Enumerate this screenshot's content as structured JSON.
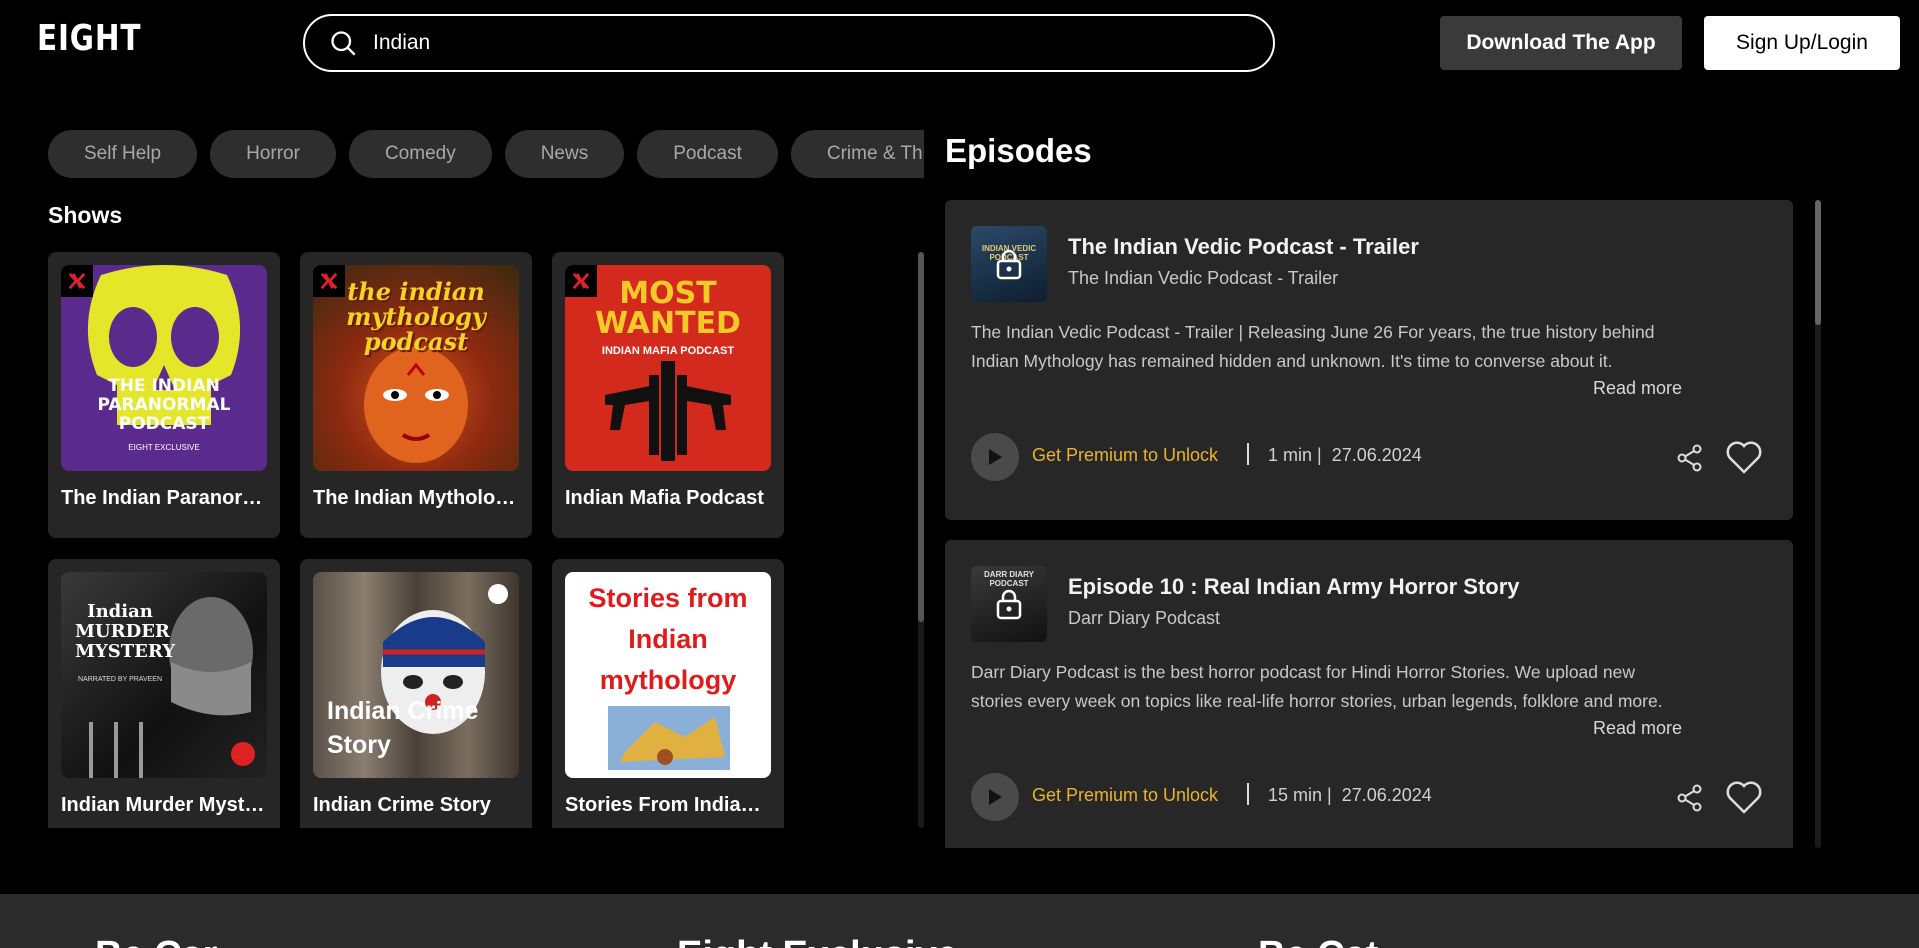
{
  "header": {
    "logo": "EIGHT",
    "search_value": "Indian",
    "download_label": "Download The App",
    "signup_label": "Sign Up/Login"
  },
  "categories": [
    "Self Help",
    "Horror",
    "Comedy",
    "News",
    "Podcast",
    "Crime & Thriller"
  ],
  "shows_title": "Shows",
  "shows": [
    {
      "title": "The Indian Paranormal Podcast",
      "art_text": "THE INDIAN PARANORMAL PODCAST",
      "art_sub": "EIGHT EXCLUSIVE",
      "exclusive": true
    },
    {
      "title": "The Indian Mythology Podcast",
      "art_text": "the indian mythology podcast",
      "exclusive": true
    },
    {
      "title": "Indian Mafia Podcast",
      "art_text": "MOST WANTED",
      "art_sub": "INDIAN MAFIA PODCAST",
      "exclusive": true
    },
    {
      "title": "Indian Murder Mystery",
      "art_text": "Indian MURDER MYSTERY",
      "art_sub": "NARRATED BY PRAVEEN",
      "exclusive": false
    },
    {
      "title": "Indian Crime Story",
      "art_text": "Indian Crime Story",
      "exclusive": false
    },
    {
      "title": "Stories From Indian Mythology",
      "art_text": "Stories from Indian mythology",
      "exclusive": false
    }
  ],
  "episodes_title": "Episodes",
  "episodes": [
    {
      "title": "The Indian Vedic Podcast - Trailer",
      "show": "The Indian Vedic Podcast - Trailer",
      "description": "The Indian Vedic Podcast - Trailer | Releasing June 26 For years, the true history behind Indian Mythology has remained hidden and unknown. It's time to converse about it.",
      "read_more": "Read more",
      "unlock": "Get Premium to Unlock",
      "meta": "1 min |  27.06.2024",
      "thumb_text": "INDIAN VEDIC PODCAST"
    },
    {
      "title": "Episode 10 : Real Indian Army Horror Story",
      "show": "Darr Diary Podcast",
      "description": "Darr Diary Podcast is the best horror podcast for Hindi Horror Stories. We upload new stories every week on topics like real-life horror stories, urban legends, folklore and more.",
      "read_more": "Read more",
      "unlock": "Get Premium to Unlock",
      "meta": "15 min |  27.06.2024",
      "thumb_text": "DARR DIARY PODCAST"
    }
  ],
  "footer": {
    "col1": "Be Car",
    "col2": "Eight Exclusive",
    "col3": "Be Cat"
  },
  "colors": {
    "background": "#000000",
    "card": "#262626",
    "premium": "#e8b42d",
    "chip": "#2e2e2e"
  }
}
